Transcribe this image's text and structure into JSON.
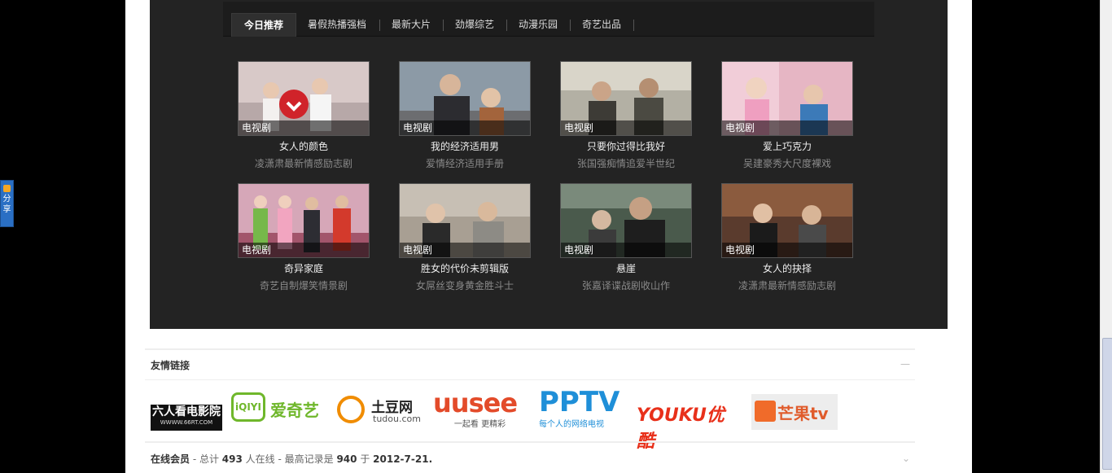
{
  "tabs": [
    "今日推荐",
    "暑假热播强档",
    "最新大片",
    "劲爆综艺",
    "动漫乐园",
    "奇艺出品"
  ],
  "items": [
    {
      "cap": "电视剧",
      "title": "女人的颜色",
      "sub": "凌潇肃最新情感励志剧"
    },
    {
      "cap": "电视剧",
      "title": "我的经济适用男",
      "sub": "爱情经济适用手册"
    },
    {
      "cap": "电视剧",
      "title": "只要你过得比我好",
      "sub": "张国强痴情追爱半世纪"
    },
    {
      "cap": "电视剧",
      "title": "爱上巧克力",
      "sub": "吴建豪秀大尺度裸戏"
    },
    {
      "cap": "电视剧",
      "title": "奇异家庭",
      "sub": "奇艺自制爆笑情景剧"
    },
    {
      "cap": "电视剧",
      "title": "胜女的代价未剪辑版",
      "sub": "女屌丝变身黄金胜斗士"
    },
    {
      "cap": "电视剧",
      "title": "悬崖",
      "sub": "张嘉译谍战剧收山作"
    },
    {
      "cap": "电视剧",
      "title": "女人的抉择",
      "sub": "凌潇肃最新情感励志剧"
    }
  ],
  "links": {
    "title": "友情链接",
    "collapse": "—",
    "logos": [
      {
        "name": "六人看电影院",
        "sub": "WWWW.66RT.COM"
      },
      {
        "name": "爱奇艺",
        "mark": "iQIYI"
      },
      {
        "name": "土豆网",
        "sub": "tudou.com"
      },
      {
        "name": "uusee",
        "sub": "一起看 更精彩"
      },
      {
        "name": "PPTV",
        "sub": "每个人的网络电视"
      },
      {
        "name": "YOUKU优酷"
      },
      {
        "name": "芒果tv"
      }
    ]
  },
  "online": {
    "label": "在线会员",
    "dash1": " - 总计 ",
    "total": "493",
    "mid": " 人在线 - 最高记录是 ",
    "max": "940",
    "yu": " 于 ",
    "date": "2012-7-21."
  },
  "share": "分享"
}
